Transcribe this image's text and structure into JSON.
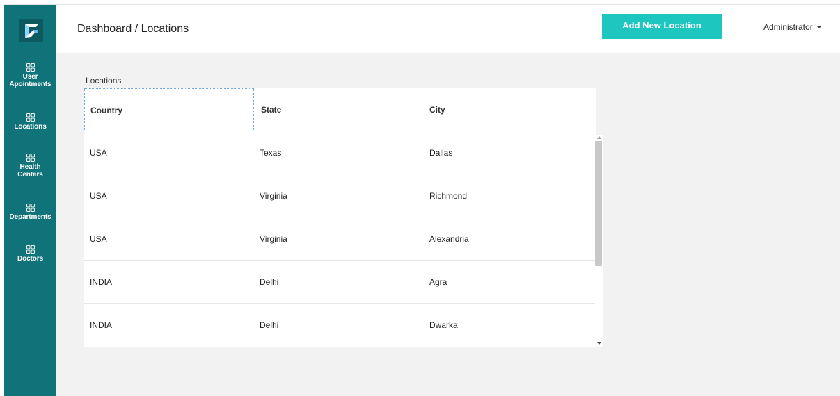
{
  "header": {
    "title": "Dashboard / Locations",
    "add_button": "Add New Location",
    "user": "Administrator"
  },
  "sidebar": {
    "items": [
      {
        "line1": "User",
        "line2": "Apointments"
      },
      {
        "line1": "Locations",
        "line2": ""
      },
      {
        "line1": "Health",
        "line2": "Centers"
      },
      {
        "line1": "Departments",
        "line2": ""
      },
      {
        "line1": "Doctors",
        "line2": ""
      }
    ]
  },
  "locations": {
    "label": "Locations",
    "columns": [
      "Country",
      "State",
      "City"
    ],
    "rows": [
      {
        "country": "USA",
        "state": "Texas",
        "city": "Dallas"
      },
      {
        "country": "USA",
        "state": "Virginia",
        "city": "Richmond"
      },
      {
        "country": "USA",
        "state": "Virginia",
        "city": "Alexandria"
      },
      {
        "country": "INDIA",
        "state": "Delhi",
        "city": "Agra"
      },
      {
        "country": "INDIA",
        "state": "Delhi",
        "city": "Dwarka"
      }
    ]
  },
  "colors": {
    "sidebar": "#0f7379",
    "accent": "#1ec6c0"
  }
}
